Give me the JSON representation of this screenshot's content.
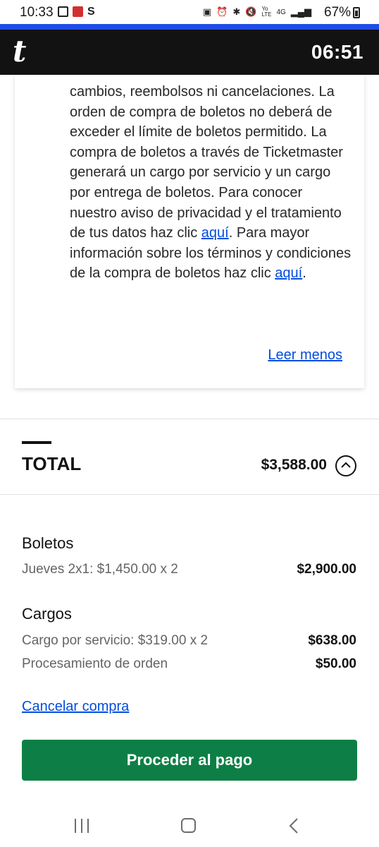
{
  "status_bar": {
    "time": "10:33",
    "battery": "67%",
    "icons": [
      "gallery-icon",
      "bank-app-icon",
      "s-app-icon",
      "battery-saver-icon",
      "alarm-icon",
      "bluetooth-icon",
      "mute-icon",
      "volte-icon",
      "4g-icon",
      "signal-icon",
      "battery-icon"
    ],
    "volte_text": "Yo LTE",
    "net_text": "4G"
  },
  "header": {
    "logo": "t",
    "timer": "06:51",
    "colors": {
      "bar": "#121212",
      "accent_line": "#1f4ce6"
    }
  },
  "terms": {
    "text_1": "cambios, reembolsos ni cancelaciones. La orden de compra de boletos no deberá de exceder el límite de boletos permitido. La compra de boletos a través de Ticketmaster generará un cargo por servicio y un cargo por entrega de boletos. Para conocer nuestro aviso de privacidad y el tratamiento de tus datos haz clic ",
    "link_1": "aquí",
    "text_2": ". Para mayor información sobre los términos y condiciones de la compra de boletos haz clic ",
    "link_2": "aquí",
    "text_3": ".",
    "read_less": "Leer menos"
  },
  "total": {
    "label": "TOTAL",
    "amount": "$3,588.00"
  },
  "tickets": {
    "title": "Boletos",
    "items": [
      {
        "label": "Jueves 2x1: $1,450.00 x 2",
        "value": "$2,900.00"
      }
    ]
  },
  "charges": {
    "title": "Cargos",
    "items": [
      {
        "label": "Cargo por servicio: $319.00 x 2",
        "value": "$638.00"
      },
      {
        "label": "Procesamiento de orden",
        "value": "$50.00"
      }
    ]
  },
  "actions": {
    "cancel": "Cancelar compra",
    "proceed": "Proceder al pago",
    "proceed_color": "#0d7f46",
    "link_color": "#024ddf"
  }
}
